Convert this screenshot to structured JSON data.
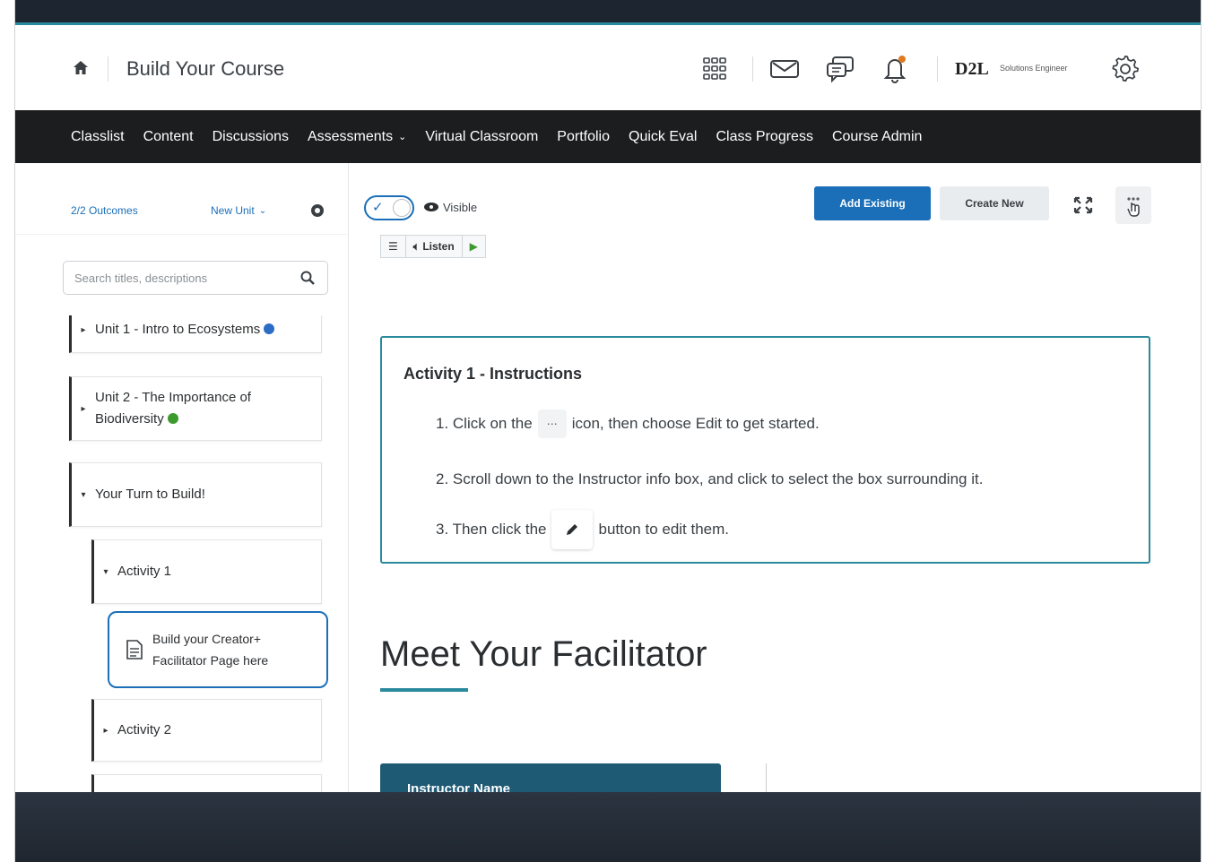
{
  "header": {
    "course_title": "Build Your Course",
    "brand": "D2L",
    "brand_subtitle": "Solutions Engineer",
    "icons": [
      "home-icon",
      "waffle-icon",
      "mail-icon",
      "chat-icon",
      "bell-icon",
      "gear-icon"
    ]
  },
  "navbar": {
    "items": [
      "Classlist",
      "Content",
      "Discussions",
      "Assessments",
      "Virtual Classroom",
      "Portfolio",
      "Quick Eval",
      "Class Progress",
      "Course Admin"
    ]
  },
  "sidebar": {
    "outcomes": "2/2 Outcomes",
    "new_unit": "New Unit",
    "search_placeholder": "Search titles, descriptions",
    "items": [
      {
        "label": "Unit 1 - Intro to Ecosystems"
      },
      {
        "label": "Unit 2 - The Importance of Biodiversity"
      },
      {
        "label": "Your Turn to Build!"
      },
      {
        "label": "Activity 1"
      },
      {
        "label": "Build your Creator+ Facilitator Page here"
      },
      {
        "label": "Activity 2"
      }
    ]
  },
  "toolbar": {
    "visibility_label": "Visible",
    "add_existing": "Add Existing",
    "create_new": "Create New",
    "listen_label": "Listen"
  },
  "instructions": {
    "title": "Activity 1 - Instructions",
    "step1_before": "1. Click on the",
    "step1_after": "icon, then choose Edit to get started.",
    "step2": "2. Scroll down to the Instructor info box, and click to select the box surrounding it.",
    "step3_before": "3. Then click the",
    "step3_after": "button to edit them."
  },
  "main": {
    "facilitator_heading": "Meet Your Facilitator",
    "instructor_card_label": "Instructor Name"
  },
  "colors": {
    "accent": "#1a6fb8",
    "teal": "#2a8a9d",
    "navbar": "#1b1d1f"
  }
}
